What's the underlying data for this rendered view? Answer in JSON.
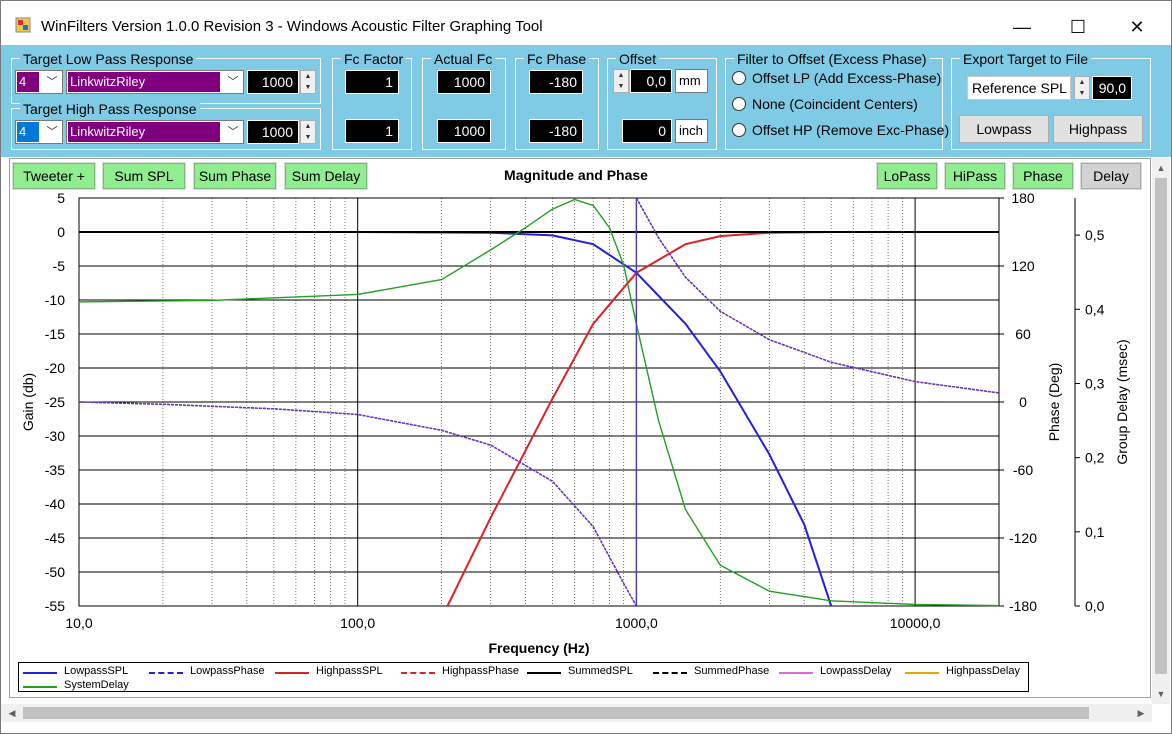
{
  "window": {
    "title": "WinFilters Version 1.0.0 Revision 3 - Windows Acoustic Filter Graphing Tool",
    "minimize": "—",
    "maximize": "☐",
    "close": "✕"
  },
  "controls": {
    "lowpass": {
      "group_title": "Target Low Pass Response",
      "order": "4",
      "type": "LinkwitzRiley",
      "frequency": "1000",
      "fc_factor": "1",
      "actual_fc": "1000",
      "fc_phase": "-180"
    },
    "highpass": {
      "group_title": "Target High Pass Response",
      "order": "4",
      "type": "LinkwitzRiley",
      "frequency": "1000",
      "fc_factor": "1",
      "actual_fc": "1000",
      "fc_phase": "-180"
    },
    "fc_factor_title": "Fc Factor",
    "actual_fc_title": "Actual Fc",
    "fc_phase_title": "Fc Phase",
    "offset": {
      "title": "Offset",
      "mm_value": "0,0",
      "mm_unit": "mm",
      "inch_value": "0",
      "inch_unit": "inch"
    },
    "filter_offset": {
      "title": "Filter to Offset (Excess Phase)",
      "options": [
        "Offset LP (Add Excess-Phase)",
        "None (Coincident Centers)",
        "Offset HP (Remove Exc-Phase)"
      ]
    },
    "export": {
      "title": "Export Target to File",
      "reference_label": "Reference SPL",
      "reference_value": "90,0",
      "lowpass_button": "Lowpass",
      "highpass_button": "Highpass"
    }
  },
  "graph_buttons": {
    "left": [
      "Tweeter +",
      "Sum SPL",
      "Sum Phase",
      "Sum Delay"
    ],
    "right": [
      "LoPass",
      "HiPass",
      "Phase",
      "Delay"
    ]
  },
  "chart_data": {
    "type": "line",
    "title": "Magnitude and Phase",
    "xlabel": "Frequency (Hz)",
    "x_scale": "log",
    "xlim": [
      10,
      20000
    ],
    "x_ticks": [
      "10,0",
      "100,0",
      "1000,0",
      "10000,0"
    ],
    "y_left": {
      "label": "Gain (db)",
      "lim": [
        -55,
        5
      ],
      "ticks": [
        "5",
        "0",
        "-5",
        "-10",
        "-15",
        "-20",
        "-25",
        "-30",
        "-35",
        "-40",
        "-45",
        "-50",
        "-55"
      ]
    },
    "y_right_phase": {
      "label": "Phase (Deg)",
      "lim": [
        -180,
        180
      ],
      "ticks": [
        "180",
        "120",
        "60",
        "0",
        "-60",
        "-120",
        "-180"
      ]
    },
    "y_right_delay": {
      "label": "Group Delay (msec)",
      "lim": [
        0,
        0.55
      ],
      "ticks": [
        "0,5",
        "0,4",
        "0,3",
        "0,2",
        "0,1",
        "0,0"
      ]
    },
    "grid": true,
    "legend_position": "bottom",
    "legend": [
      "LowpassSPL",
      "LowpassPhase",
      "HighpassSPL",
      "HighpassPhase",
      "SummedSPL",
      "SummedPhase",
      "LowpassDelay",
      "HighpassDelay",
      "SystemDelay"
    ],
    "series": [
      {
        "name": "LowpassSPL",
        "color": "#2222dd",
        "axis": "gain",
        "x": [
          10,
          100,
          300,
          500,
          700,
          1000,
          1500,
          2000,
          3000,
          4000,
          5000
        ],
        "y": [
          0,
          0,
          -0.1,
          -0.5,
          -1.8,
          -6.0,
          -13.5,
          -20.5,
          -32.7,
          -43.0,
          -55.0
        ]
      },
      {
        "name": "HighpassSPL",
        "color": "#dd2222",
        "axis": "gain",
        "x": [
          210,
          300,
          500,
          700,
          1000,
          1500,
          2000,
          3000,
          5000,
          20000
        ],
        "y": [
          -55.0,
          -42.0,
          -24.5,
          -13.5,
          -6.0,
          -1.8,
          -0.6,
          -0.1,
          0,
          0
        ]
      },
      {
        "name": "SummedSPL",
        "color": "#000000",
        "axis": "gain",
        "x": [
          10,
          20000
        ],
        "y": [
          0,
          0
        ]
      },
      {
        "name": "LowpassPhase",
        "color": "#4b3bbf",
        "axis": "phase",
        "dashed": true,
        "x": [
          10,
          20,
          50,
          100,
          200,
          300,
          500,
          700,
          900,
          1000,
          1000,
          1200,
          1500,
          2000,
          3000,
          5000,
          10000,
          20000
        ],
        "y": [
          0,
          -2,
          -6,
          -11,
          -25,
          -38,
          -70,
          -110,
          -160,
          -180,
          180,
          145,
          110,
          80,
          55,
          35,
          18,
          8
        ]
      },
      {
        "name": "HighpassPhase",
        "color": "#6a2fbf",
        "axis": "phase",
        "dashed": true,
        "x": [
          10,
          20,
          50,
          100,
          200,
          300,
          500,
          700,
          900,
          1000,
          1000,
          1200,
          1500,
          2000,
          3000,
          5000,
          10000,
          20000
        ],
        "y": [
          0,
          -2,
          -6,
          -11,
          -25,
          -38,
          -70,
          -110,
          -160,
          -180,
          180,
          145,
          110,
          80,
          55,
          35,
          18,
          8
        ]
      },
      {
        "name": "SystemDelay",
        "color": "#22a022",
        "axis": "delay",
        "x": [
          10,
          30,
          100,
          200,
          300,
          400,
          500,
          600,
          700,
          800,
          900,
          1000,
          1200,
          1500,
          2000,
          3000,
          5000,
          10000,
          20000
        ],
        "y": [
          0.41,
          0.412,
          0.42,
          0.44,
          0.48,
          0.51,
          0.535,
          0.548,
          0.54,
          0.51,
          0.46,
          0.38,
          0.25,
          0.13,
          0.055,
          0.02,
          0.007,
          0.002,
          0.0005
        ]
      }
    ]
  }
}
